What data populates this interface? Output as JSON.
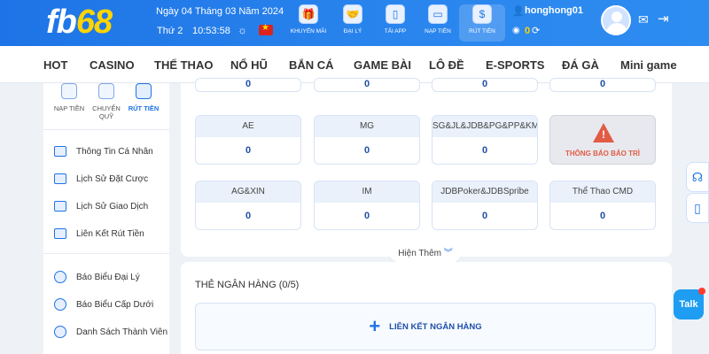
{
  "header": {
    "logo_text": "fb",
    "logo_num": "68",
    "date": "Ngày 04 Tháng 03 Năm 2024",
    "weekday": "Thứ 2",
    "time": "10:53:58",
    "quick_links": [
      {
        "label": "KHUYẾN MÃI",
        "icon": "gift-icon"
      },
      {
        "label": "ĐẠI LÝ",
        "icon": "handshake-icon"
      },
      {
        "label": "TẢI APP",
        "icon": "phone-download-icon"
      },
      {
        "label": "NẠP TIỀN",
        "icon": "wallet-icon"
      },
      {
        "label": "RÚT TIỀN",
        "icon": "money-bag-icon"
      }
    ],
    "username": "honghong01",
    "balance": "0"
  },
  "nav": [
    "HOT",
    "CASINO",
    "THỂ THAO",
    "NỔ HŨ",
    "BẮN CÁ",
    "GAME BÀI",
    "LÔ ĐỀ",
    "E-SPORTS",
    "ĐÁ GÀ",
    "Mini game"
  ],
  "sidebar": {
    "quick": [
      {
        "label": "NẠP TIỀN"
      },
      {
        "label": "CHUYỂN QUỸ"
      },
      {
        "label": "RÚT TIỀN"
      }
    ],
    "menu": [
      "Thông Tin Cá Nhân",
      "Lịch Sử Đặt Cược",
      "Lịch Sử Giao Dịch",
      "Liên Kết Rút Tiền",
      "Báo Biểu Đại Lý",
      "Báo Biểu Cấp Dưới",
      "Danh Sách Thành Viên"
    ]
  },
  "wallets": {
    "top_values": [
      "0",
      "0",
      "0",
      "0"
    ],
    "row1": [
      {
        "name": "AE",
        "value": "0"
      },
      {
        "name": "MG",
        "value": "0"
      },
      {
        "name": "SG&JL&JDB&PG&PP&KM",
        "value": "0"
      }
    ],
    "maintenance_label": "THÔNG BÁO BẢO TRÌ",
    "row2": [
      {
        "name": "AG&XIN",
        "value": "0"
      },
      {
        "name": "IM",
        "value": "0"
      },
      {
        "name": "JDBPoker&JDBSpribe",
        "value": "0"
      },
      {
        "name": "Thể Thao CMD",
        "value": "0"
      }
    ],
    "show_more": "Hiện Thêm"
  },
  "bank": {
    "title": "THẺ NGÂN HÀNG  (0/5)",
    "link_label": "LIÊN KẾT NGÂN HÀNG"
  },
  "widgets": {
    "talk_label": "Talk"
  }
}
